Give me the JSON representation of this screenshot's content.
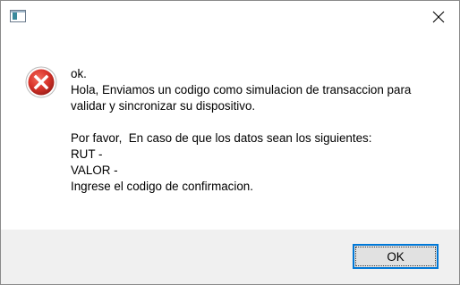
{
  "window": {
    "title": ""
  },
  "message": {
    "line1": "ok.",
    "line2": "Hola, Enviamos un codigo como simulacion de transaccion para",
    "line3": "validar y sincronizar su dispositivo.",
    "line4": "Por favor,  En caso de que los datos sean los siguientes:",
    "line5": "RUT -",
    "line6": "VALOR -",
    "line7": "Ingrese el codigo de confirmacion."
  },
  "buttons": {
    "ok_label": "OK"
  },
  "icons": {
    "app": "app-window-icon",
    "error": "error-icon",
    "close": "close-icon"
  },
  "colors": {
    "error_red": "#d9342b",
    "focus_blue": "#0078d7",
    "footer_bg": "#f0f0f0"
  }
}
